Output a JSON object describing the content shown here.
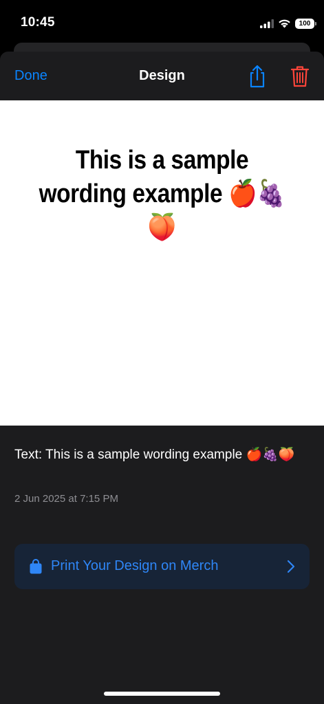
{
  "status_bar": {
    "time": "10:45",
    "battery": "100"
  },
  "nav": {
    "done_label": "Done",
    "title": "Design",
    "share_icon": "share-icon",
    "trash_icon": "trash-icon"
  },
  "canvas": {
    "preview_text": "This is a sample wording example 🍎🍇🍑"
  },
  "details": {
    "title": "Text: This is a sample wording example 🍎🍇🍑",
    "date": "2 Jun 2025 at 7:15 PM"
  },
  "merch": {
    "label": "Print Your Design on Merch",
    "icon": "shopping-bag-icon"
  },
  "colors": {
    "accent": "#0a84ff",
    "destructive": "#ff453a",
    "sheet_background": "#1c1c1e",
    "button_background": "#172437"
  }
}
